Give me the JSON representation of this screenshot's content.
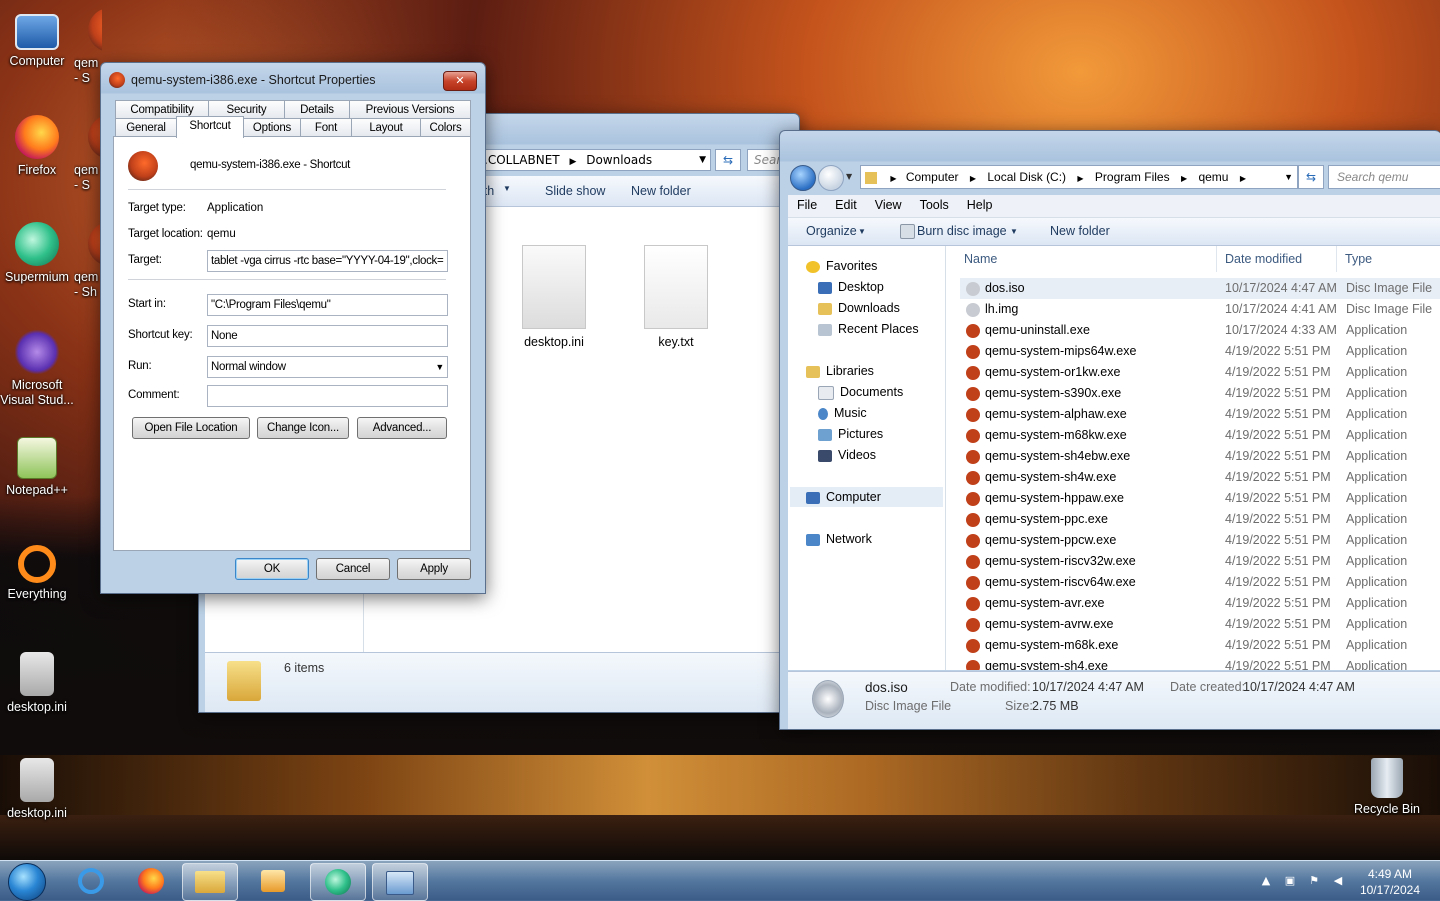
{
  "desktop": {
    "icons": [
      {
        "label": "Computer"
      },
      {
        "label": "Firefox"
      },
      {
        "label": "Supermium"
      },
      {
        "label": "Microsoft Visual Stud..."
      },
      {
        "label": "Notepad++"
      },
      {
        "label": "Everything"
      },
      {
        "label": "desktop.ini"
      },
      {
        "label": "desktop.ini"
      },
      {
        "label": "Recycle Bin"
      }
    ],
    "partial_icons": [
      {
        "label": "qem - S"
      },
      {
        "label": "qem - S"
      },
      {
        "label": "qem - Sh"
      }
    ]
  },
  "back_explorer": {
    "address_parts": [
      ".COLLABNET",
      "Downloads"
    ],
    "search_placeholder": "Sear",
    "commands": [
      "ith",
      "Slide show",
      "New folder"
    ],
    "files": [
      {
        "name": "desktop.ini"
      },
      {
        "name": "key.txt"
      }
    ],
    "status": "6 items"
  },
  "front_explorer": {
    "address_parts": [
      "Computer",
      "Local Disk (C:)",
      "Program Files",
      "qemu"
    ],
    "search_placeholder": "Search qemu",
    "menu": [
      "File",
      "Edit",
      "View",
      "Tools",
      "Help"
    ],
    "commands": {
      "organize": "Organize",
      "burn": "Burn disc image",
      "new_folder": "New folder"
    },
    "nav": {
      "favorites": "Favorites",
      "favorite_items": [
        "Desktop",
        "Downloads",
        "Recent Places"
      ],
      "libraries": "Libraries",
      "library_items": [
        "Documents",
        "Music",
        "Pictures",
        "Videos"
      ],
      "computer": "Computer",
      "network": "Network"
    },
    "columns": {
      "name": "Name",
      "date": "Date modified",
      "type": "Type"
    },
    "files": [
      {
        "name": "dos.iso",
        "date": "10/17/2024 4:47 AM",
        "type": "Disc Image File"
      },
      {
        "name": "lh.img",
        "date": "10/17/2024 4:41 AM",
        "type": "Disc Image File"
      },
      {
        "name": "qemu-uninstall.exe",
        "date": "10/17/2024 4:33 AM",
        "type": "Application"
      },
      {
        "name": "qemu-system-mips64w.exe",
        "date": "4/19/2022 5:51 PM",
        "type": "Application"
      },
      {
        "name": "qemu-system-or1kw.exe",
        "date": "4/19/2022 5:51 PM",
        "type": "Application"
      },
      {
        "name": "qemu-system-s390x.exe",
        "date": "4/19/2022 5:51 PM",
        "type": "Application"
      },
      {
        "name": "qemu-system-alphaw.exe",
        "date": "4/19/2022 5:51 PM",
        "type": "Application"
      },
      {
        "name": "qemu-system-m68kw.exe",
        "date": "4/19/2022 5:51 PM",
        "type": "Application"
      },
      {
        "name": "qemu-system-sh4ebw.exe",
        "date": "4/19/2022 5:51 PM",
        "type": "Application"
      },
      {
        "name": "qemu-system-sh4w.exe",
        "date": "4/19/2022 5:51 PM",
        "type": "Application"
      },
      {
        "name": "qemu-system-hppaw.exe",
        "date": "4/19/2022 5:51 PM",
        "type": "Application"
      },
      {
        "name": "qemu-system-ppc.exe",
        "date": "4/19/2022 5:51 PM",
        "type": "Application"
      },
      {
        "name": "qemu-system-ppcw.exe",
        "date": "4/19/2022 5:51 PM",
        "type": "Application"
      },
      {
        "name": "qemu-system-riscv32w.exe",
        "date": "4/19/2022 5:51 PM",
        "type": "Application"
      },
      {
        "name": "qemu-system-riscv64w.exe",
        "date": "4/19/2022 5:51 PM",
        "type": "Application"
      },
      {
        "name": "qemu-system-avr.exe",
        "date": "4/19/2022 5:51 PM",
        "type": "Application"
      },
      {
        "name": "qemu-system-avrw.exe",
        "date": "4/19/2022 5:51 PM",
        "type": "Application"
      },
      {
        "name": "qemu-system-m68k.exe",
        "date": "4/19/2022 5:51 PM",
        "type": "Application"
      },
      {
        "name": "qemu-system-sh4.exe",
        "date": "4/19/2022 5:51 PM",
        "type": "Application"
      }
    ],
    "details": {
      "name": "dos.iso",
      "kind": "Disc Image File",
      "modified_label": "Date modified:",
      "modified": "10/17/2024 4:47 AM",
      "created_label": "Date created:",
      "created": "10/17/2024 4:47 AM",
      "size_label": "Size:",
      "size": "2.75 MB"
    }
  },
  "properties": {
    "title": "qemu-system-i386.exe - Shortcut Properties",
    "tabs_top": [
      "Compatibility",
      "Security",
      "Details",
      "Previous Versions"
    ],
    "tabs_bottom": [
      "General",
      "Shortcut",
      "Options",
      "Font",
      "Layout",
      "Colors"
    ],
    "active_tab": "Shortcut",
    "shortcut_name": "qemu-system-i386.exe - Shortcut",
    "fields": {
      "target_type_label": "Target type:",
      "target_type": "Application",
      "target_location_label": "Target location:",
      "target_location": "qemu",
      "target_label": "Target:",
      "target": "tablet -vga cirrus -rtc base=\"YYYY-04-19\",clock=",
      "start_in_label": "Start in:",
      "start_in": "\"C:\\Program Files\\qemu\"",
      "shortcut_key_label": "Shortcut key:",
      "shortcut_key": "None",
      "run_label": "Run:",
      "run": "Normal window",
      "comment_label": "Comment:",
      "comment": ""
    },
    "buttons": {
      "open_location": "Open File Location",
      "change_icon": "Change Icon...",
      "advanced": "Advanced...",
      "ok": "OK",
      "cancel": "Cancel",
      "apply": "Apply"
    }
  },
  "taskbar": {
    "time": "4:49 AM",
    "date": "10/17/2024"
  },
  "colors": {
    "window_frame": "#aac3de",
    "accent_blue": "#2a86d4",
    "qemu_icon": "#c0401a"
  }
}
